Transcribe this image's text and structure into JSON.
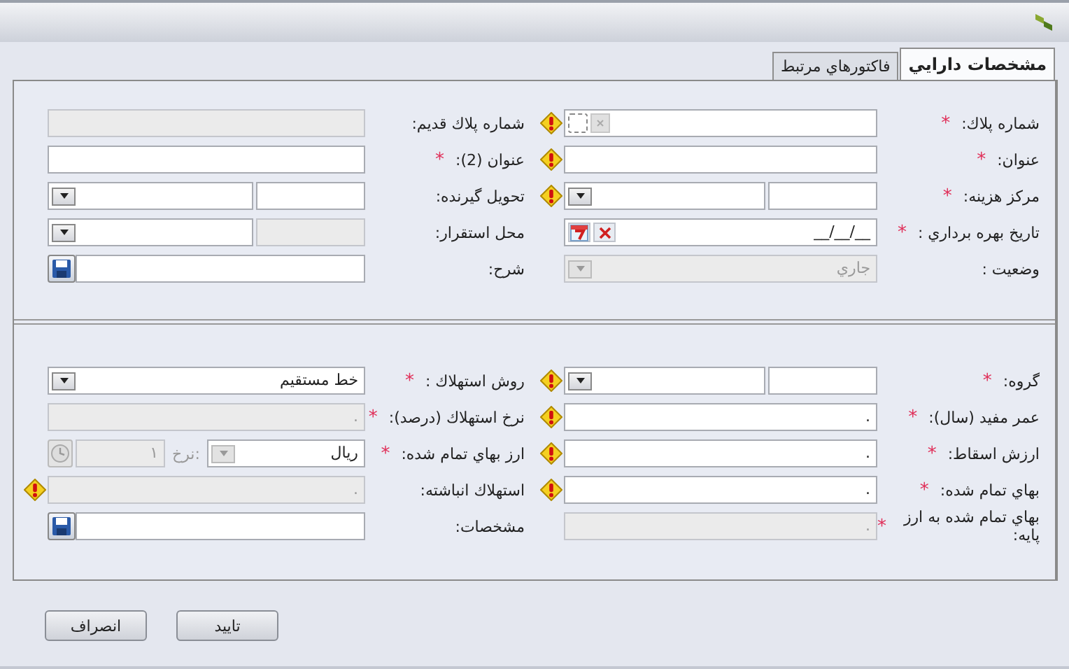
{
  "tabs": [
    {
      "label": "مشخصات دارايي",
      "selected": true
    },
    {
      "label": "فاكتورهاي مرتبط",
      "selected": false
    }
  ],
  "sections": [
    {
      "rows": [
        {
          "right": {
            "label": "شماره پلاك:",
            "required_mark": "*",
            "warning": true,
            "field": {
              "kind": "plate",
              "disabled": false
            }
          },
          "left": {
            "label": "شماره پلاك قديم:",
            "field": {
              "kind": "text",
              "disabled": true
            }
          }
        },
        {
          "right": {
            "label": "عنوان:",
            "required_mark": "*",
            "warning": true,
            "field": {
              "kind": "text",
              "disabled": false
            }
          },
          "left": {
            "label": "عنوان (2):",
            "required_mark": "*",
            "field": {
              "kind": "text",
              "disabled": false
            }
          }
        },
        {
          "right": {
            "label": "مركز هزينه:",
            "required_mark": "*",
            "warning": true,
            "field": {
              "kind": "split-combo",
              "disabled": false,
              "code_disabled": false
            }
          },
          "left": {
            "label": "تحويل گيرنده:",
            "field": {
              "kind": "split-combo",
              "disabled": false,
              "code_disabled": false
            }
          }
        },
        {
          "right": {
            "label": "تاريخ بهره برداري :",
            "required_mark": "*",
            "field": {
              "kind": "date",
              "disabled": false,
              "value": "__/__/__"
            }
          },
          "left": {
            "label": "محل استقرار:",
            "field": {
              "kind": "split-combo",
              "disabled": false,
              "code_disabled": true
            }
          }
        },
        {
          "right": {
            "label": "وضعيت :",
            "field": {
              "kind": "combo",
              "disabled": true,
              "value": "جاري"
            }
          },
          "left": {
            "label": "شرح:",
            "field": {
              "kind": "memo",
              "disabled": false
            }
          }
        }
      ]
    },
    {
      "rows": [
        {
          "right": {
            "label": "گروه:",
            "required_mark": "*",
            "warning": true,
            "field": {
              "kind": "split-combo",
              "disabled": false,
              "code_disabled": false
            }
          },
          "left": {
            "label": "روش استهلاك :",
            "required_mark": "*",
            "field": {
              "kind": "combo",
              "disabled": false,
              "value": "خط مستقيم"
            }
          }
        },
        {
          "right": {
            "label": "عمر مفيد (سال):",
            "required_mark": "*",
            "warning": true,
            "field": {
              "kind": "text",
              "disabled": false,
              "value": "."
            }
          },
          "left": {
            "label": "نرخ استهلاك (درصد):",
            "required_mark": "*",
            "field": {
              "kind": "text",
              "disabled": true,
              "value": "."
            }
          }
        },
        {
          "right": {
            "label": "ارزش اسقاط:",
            "required_mark": "*",
            "warning": true,
            "field": {
              "kind": "text",
              "disabled": false,
              "value": "."
            }
          },
          "left": {
            "label": "ارز بهاي تمام شده:",
            "required_mark": "*",
            "field": {
              "kind": "currency",
              "disabled": false,
              "value": "ريال",
              "rate_label": "نرخ:",
              "rate": "١"
            }
          }
        },
        {
          "right": {
            "label": "بهاي تمام شده:",
            "required_mark": "*",
            "warning": true,
            "field": {
              "kind": "text",
              "disabled": false,
              "value": "."
            }
          },
          "left": {
            "label": "استهلاك انباشته:",
            "warning": true,
            "field": {
              "kind": "text",
              "disabled": true,
              "value": "."
            }
          }
        },
        {
          "right": {
            "label": "بهاي تمام شده به ارز پايه:",
            "required_mark": "*",
            "field": {
              "kind": "text",
              "disabled": true,
              "value": "."
            }
          },
          "left": {
            "label": "مشخصات:",
            "field": {
              "kind": "memo",
              "disabled": false
            }
          }
        }
      ]
    }
  ],
  "buttons": [
    "تاييد",
    "انصراف"
  ]
}
